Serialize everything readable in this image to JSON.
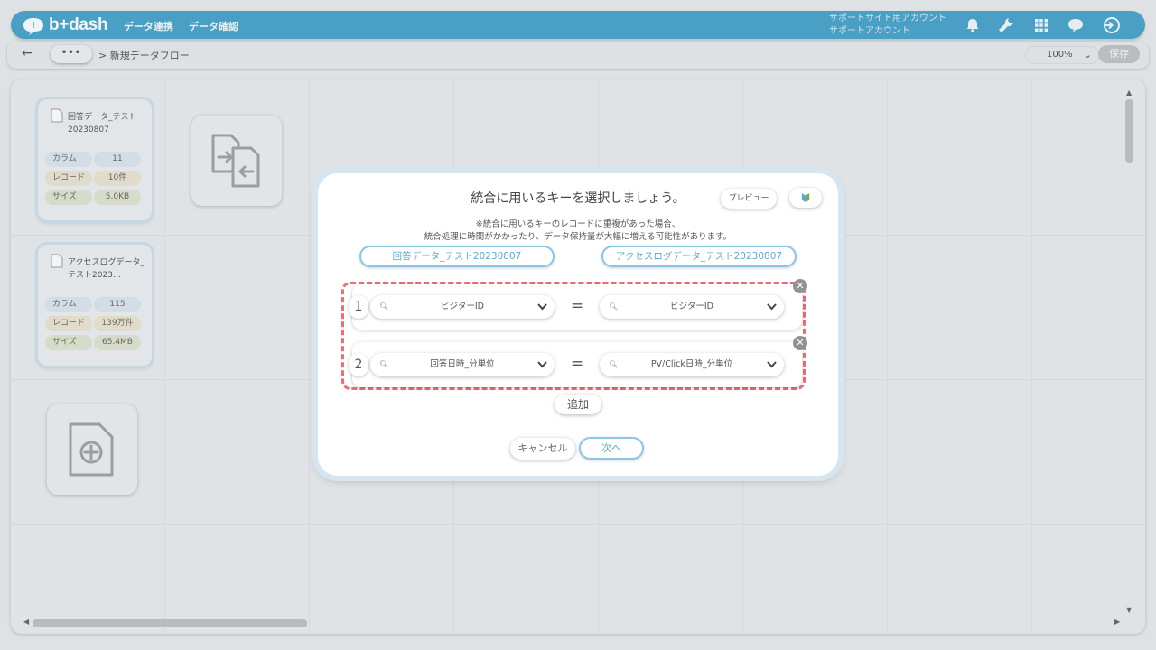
{
  "app": {
    "logo_text": "b+dash",
    "nav": [
      "データ連携",
      "データ確認"
    ],
    "account": {
      "line1": "サポートサイト用アカウント",
      "line2": "サポートアカウント"
    },
    "icons": [
      "bell-icon",
      "wrench-icon",
      "grid-icon",
      "chat-icon",
      "logout-icon"
    ]
  },
  "breadcrumb": {
    "back": "←",
    "more": "•••",
    "path": "> 新規データフロー"
  },
  "toolbar": {
    "zoom": "100%",
    "save_label": "保存"
  },
  "canvas": {
    "files": [
      {
        "name": "回答データ_テスト20230807",
        "stats": [
          {
            "label": "カラム",
            "value": "11"
          },
          {
            "label": "レコード",
            "value": "10件"
          },
          {
            "label": "サイズ",
            "value": "5.0KB"
          }
        ]
      },
      {
        "name": "アクセスログデータ_テスト2023…",
        "stats": [
          {
            "label": "カラム",
            "value": "115"
          },
          {
            "label": "レコード",
            "value": "139万件"
          },
          {
            "label": "サイズ",
            "value": "65.4MB"
          }
        ]
      }
    ]
  },
  "dialog": {
    "title": "統合に用いるキーを選択しましょう。",
    "preview_label": "プレビュー",
    "note_line1": "※統合に用いるキーのレコードに重複があった場合、",
    "note_line2": "統合処理に時間がかかったり、データ保持量が大幅に増える可能性があります。",
    "left_source": "回答データ_テスト20230807",
    "right_source": "アクセスログデータ_テスト20230807",
    "rows": [
      {
        "num": "1",
        "left": "ビジターID",
        "eq": "=",
        "right": "ビジターID"
      },
      {
        "num": "2",
        "left": "回答日時_分単位",
        "eq": "=",
        "right": "PV/Click日時_分単位"
      }
    ],
    "add_label": "追加",
    "cancel_label": "キャンセル",
    "next_label": "次へ"
  },
  "colors": {
    "header": "#4a9fc4",
    "accent": "#5fa9cf",
    "highlight_dashed": "#ef6b78"
  }
}
